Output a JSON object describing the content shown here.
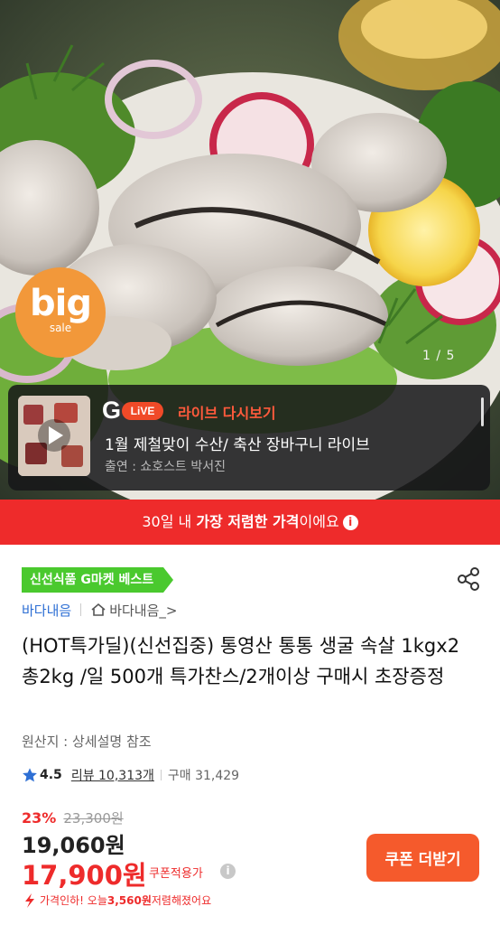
{
  "hero": {
    "sale_badge": {
      "big": "big",
      "sale": "sale"
    },
    "pager": {
      "current": "1",
      "separator": "/",
      "total": "5"
    },
    "live_card": {
      "brand_g": "G",
      "badge": "LiVE",
      "title": "라이브 다시보기",
      "main_text": "1월 제철맞이 수산/ 축산 장바구니 라이브",
      "sub_text": "출연 : 쇼호스트 박서진"
    }
  },
  "price_banner": {
    "prefix": "30일 내 ",
    "highlight": "가장 저렴한 가격",
    "suffix": "이에요",
    "info_icon": "i"
  },
  "product": {
    "best_badge": "신선식품 G마켓 베스트",
    "brand": "바다내음",
    "shop": "바다내음_>",
    "title": "(HOT특가딜)(신선집중) 통영산 통통 생굴 속살 1kgx2 총2kg /일 500개 특가찬스/2개이상 구매시 초장증정",
    "origin": "원산지 : 상세설명 참조",
    "rating": "4.5",
    "reviews": "리뷰 10,313개",
    "purchases": "구매 31,429"
  },
  "pricing": {
    "discount_pct": "23%",
    "original_price": "23,300원",
    "price": "19,060원",
    "coupon_price": "17,900원",
    "coupon_label": "쿠폰적용가",
    "coupon_info_icon": "i",
    "drop_prefix": "가격인하! 오늘 ",
    "drop_amount": "3,560원",
    "drop_suffix": " 저렴해졌어요",
    "coupon_button": "쿠폰 더받기"
  },
  "colors": {
    "accent_red": "#ee2b2b",
    "badge_green": "#4ac92e",
    "button_orange": "#f55a2c",
    "link_blue": "#2e6fd4"
  }
}
